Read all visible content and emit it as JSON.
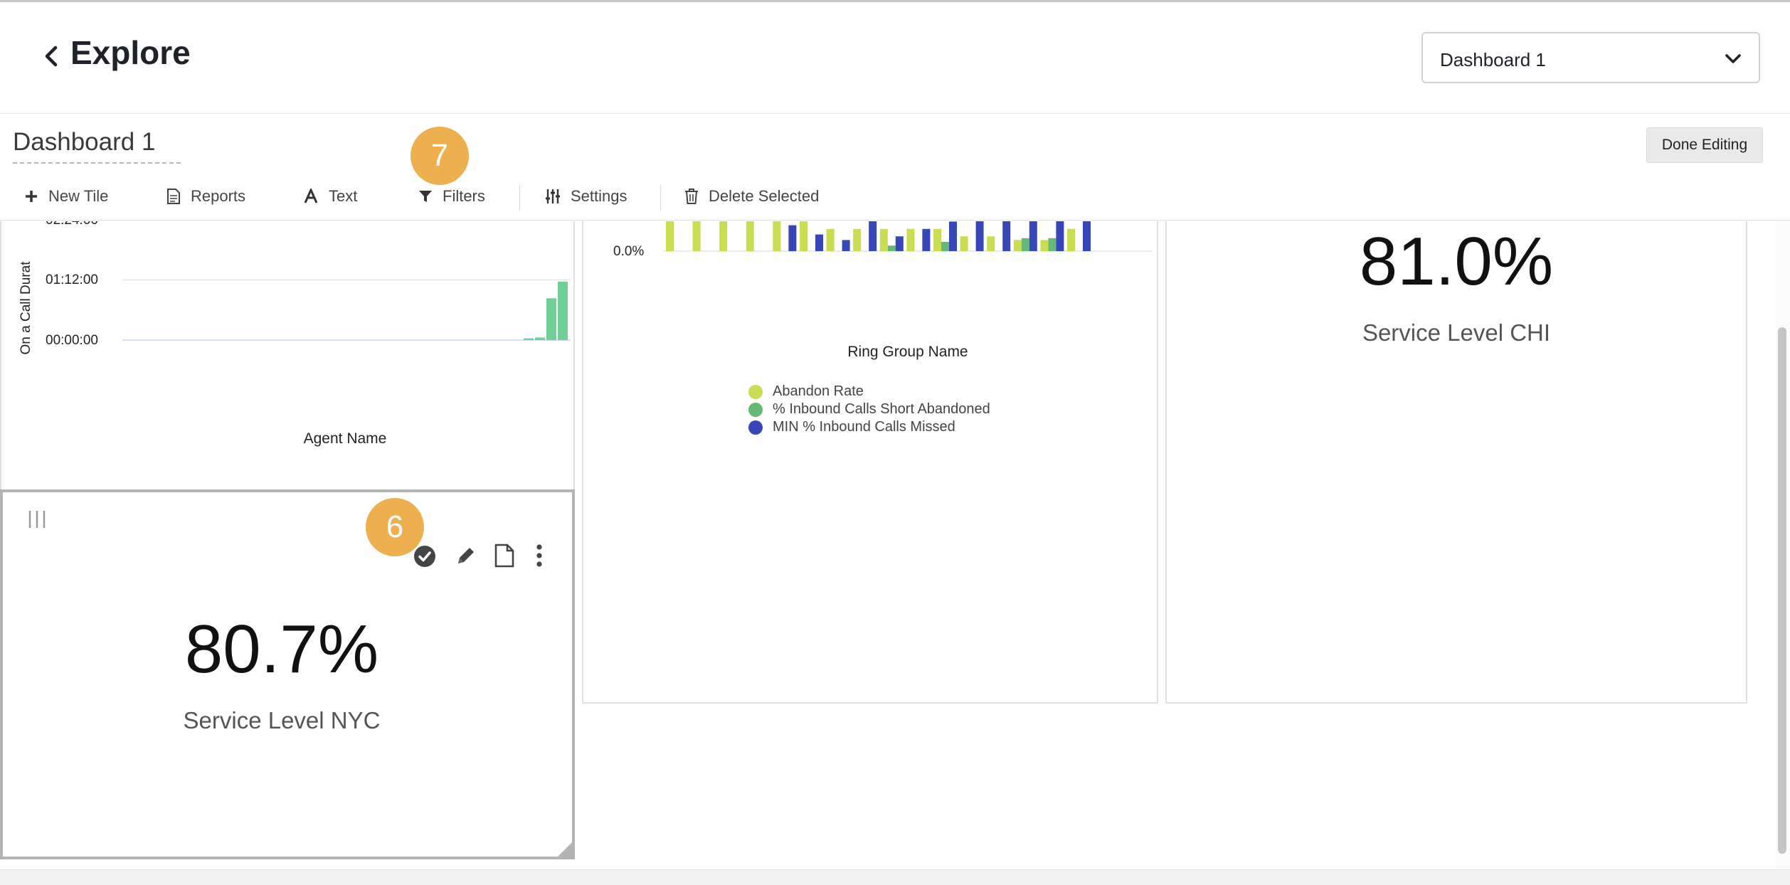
{
  "header": {
    "title": "Explore",
    "dashboard_select": "Dashboard 1"
  },
  "editbar": {
    "dashboard_name": "Dashboard 1",
    "done_label": "Done Editing",
    "tools": [
      "New Tile",
      "Reports",
      "Text",
      "Filters",
      "Settings",
      "Delete Selected"
    ]
  },
  "badges": {
    "filters_step": "7",
    "tile_step": "6"
  },
  "tiles": {
    "agent_chart": {
      "ylabel": "On a Call Durat",
      "yticks": [
        "00:00:00",
        "01:12:00",
        "02:24:00"
      ],
      "xlabel": "Agent Name"
    },
    "ring_chart": {
      "ytick": "0.0%",
      "xlabel": "Ring Group Name",
      "legend": [
        "Abandon Rate",
        "% Inbound Calls Short Abandoned",
        "MIN % Inbound Calls Missed"
      ]
    },
    "kpi_chi": {
      "value": "81.0%",
      "label": "Service Level CHI"
    },
    "kpi_nyc": {
      "value": "80.7%",
      "label": "Service Level NYC"
    }
  },
  "colors": {
    "lime": "#c9dc52",
    "green": "#66b877",
    "blue": "#3847b8",
    "bar_green": "#6fcf97",
    "badge": "#eeb04f"
  },
  "chart_data": [
    {
      "type": "bar",
      "xlabel": "Agent Name",
      "ylabel": "On a Call Durat",
      "y_ticks": [
        "00:00:00",
        "01:12:00",
        "02:24:00"
      ],
      "values_minutes": [
        2,
        3,
        50,
        70
      ]
    },
    {
      "type": "bar",
      "xlabel": "Ring Group Name",
      "y_ticks": [
        "0.0%"
      ],
      "series": [
        {
          "name": "Abandon Rate",
          "values": [
            1.0,
            1.0,
            1.0,
            1.0,
            1.0,
            1.0,
            0.6,
            0.6,
            0.6,
            0.6,
            0.6,
            0.4,
            0.4,
            0.3,
            0.3,
            0.6
          ]
        },
        {
          "name": "% Inbound Calls Short Abandoned",
          "values": [
            0,
            0,
            0,
            0,
            0,
            0,
            0,
            0,
            0.15,
            0,
            0.25,
            0,
            0,
            0.35,
            0.35,
            0
          ]
        },
        {
          "name": "MIN % Inbound Calls Missed",
          "values": [
            0,
            0,
            0,
            0,
            0.7,
            0.45,
            0.3,
            1.0,
            0.4,
            0.6,
            0.8,
            1.0,
            1.0,
            1.0,
            0.9,
            1.0
          ]
        }
      ]
    }
  ]
}
